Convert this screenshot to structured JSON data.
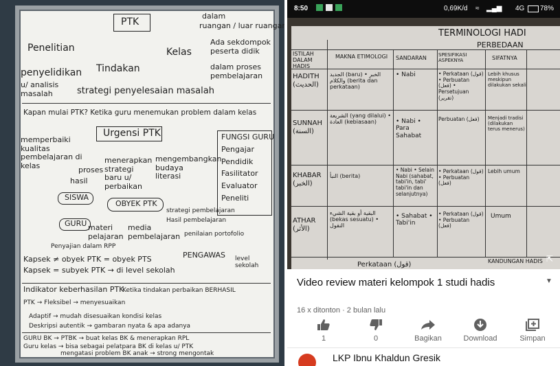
{
  "status_bar": {
    "time": "8:50",
    "speed": "0,69K/d",
    "network": "4G",
    "battery": "78%"
  },
  "whiteboard": {
    "heading": "PTK",
    "line_kelas_1": "dalam",
    "line_kelas_2": "ruangan / luar ruangan",
    "col_a": "Penelitian",
    "col_a2": "penyelidikan",
    "col_a3": "u/ analisis masalah",
    "col_b": "Tindakan",
    "col_b2": "strategi penyelesaian masalah",
    "col_c": "Kelas",
    "col_c2": "Ada sekdompok peserta didik",
    "col_c3": "dalam proses pembelajaran",
    "question": "Kapan mulai PTK? Ketika guru menemukan problem dalam kelas",
    "urgensi": "Urgensi PTK",
    "fungsi": "FUNGSI GURU",
    "memperbaiki": "memperbaiki kualitas pembelajaran di kelas",
    "proses": "proses",
    "hasil": "hasil",
    "menerapkan": "menerapkan strategi baru u/ perbaikan",
    "mengembangkan": "mengembangkan budaya literasi",
    "fungsi_list": [
      "Pengajar",
      "Pendidik",
      "Fasilitator",
      "Evaluator",
      "Peneliti"
    ],
    "objek": "OBYEK PTK",
    "siswa": "SISWA",
    "guru": "GURU",
    "materi": "materi pelajaran",
    "media": "media pembelajaran",
    "strategi": "strategi pembelajaran",
    "hasil_pemb": "Hasil pembelajaran",
    "penilaian": "penilaian portofolio",
    "rpp": "Penyajian dalam RPP",
    "kapsek": "Kapsek ≠ obyek PTK = obyek PTS",
    "kapsek2": "Kapsek = subyek PTK → di level sekolah",
    "pengawas": "PENGAWAS",
    "level_sekolah": "level sekolah",
    "indikator": "Indikator keberhasilan PTK",
    "indikator2": "Ketika tindakan perbaikan BERHASIL",
    "fleksibel": "PTK → Fleksibel → menyesuaikan",
    "adaptif": "Adaptif → mudah disesuaikan kondisi kelas",
    "deskripsi": "Deskripsi autentik → gambaran nyata & apa adanya",
    "guru_bk": "GURU BK → PTBK → buat kelas BK & menerapkan RPL",
    "guru_kelas": "Guru kelas → bisa sebagai pelatpara BK di kelas u/ PTK",
    "mengatasi": "mengatasi problem BK anak → strong mengontak"
  },
  "video_sheet": {
    "title": "TERMINOLOGI HADI",
    "perbedaan": "PERBEDAAN",
    "headers": [
      "ISTILAH DALAM HADIS",
      "MAKNA ETIMOLOGI",
      "SANDARAN",
      "SPESIFIKASI ASPEKNYA",
      "SIFATNYA"
    ],
    "rows": [
      {
        "term": "HADITH (الحديث)",
        "makna": "الجديد (baru) • الخبر والكلام (berita dan perkataan)",
        "sandaran": "• Nabi",
        "spek": "• Perkataan (قول) • Perbuatan (فعل) • Persetujuan (تقرير)",
        "sifat": "Lebih khusus meskipun dilakukan sekali"
      },
      {
        "term": "SUNNAH (السنة)",
        "makna": "الشريعة (yang dilalui) • العادة (kebiasaan)",
        "sandaran": "• Nabi • Para Sahabat",
        "spek": "Perbuatan (فعل)",
        "sifat": "Menjadi tradisi (dilakukan terus menerus)"
      },
      {
        "term": "KHABAR (الخبر)",
        "makna": "النبأ (berita)",
        "sandaran": "• Nabi • Selain Nabi (sahabat, tabi'in, tabi' tabi'in dan selanjutnya)",
        "spek": "• Perkataan (قول) • Perbuatan (فعل)",
        "sifat": "Lebih umum"
      },
      {
        "term": "ATHAR (الأثر)",
        "makna": "البقية أو بقية الشيء (bekas sesuatu) • النقول",
        "sandaran": "• Sahabat • Tabi'in",
        "spek": "• Perkataan (قول) • Perbuatan (فعل)",
        "sifat": "Umum"
      }
    ],
    "footer_left": "Perkataan (قول)",
    "footer_right": "KANDUNGAN HADIS"
  },
  "video": {
    "title": "Video review materi kelompok 1 studi hadis",
    "views": "16 x ditonton",
    "age": "2 bulan lalu",
    "separator": "·",
    "likes": "1",
    "dislikes": "0",
    "share_label": "Bagikan",
    "download_label": "Download",
    "save_label": "Simpan",
    "channel_name": "LKP Ibnu Khaldun Gresik"
  }
}
